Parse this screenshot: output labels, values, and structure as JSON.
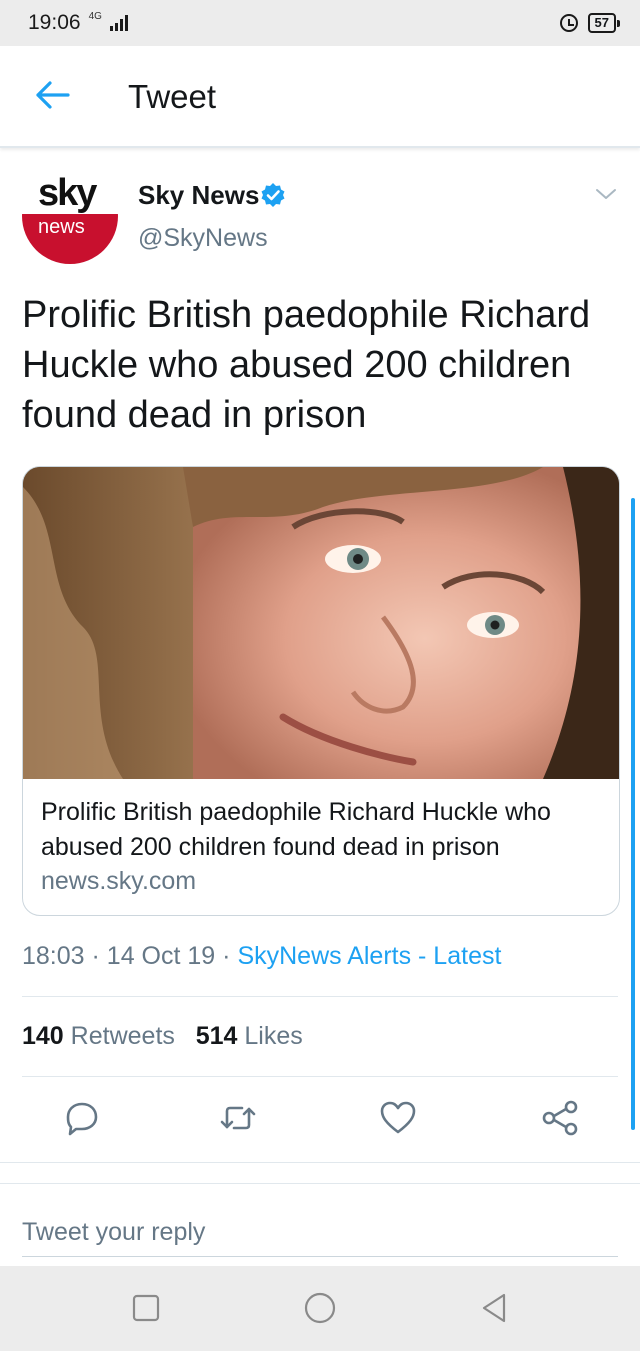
{
  "status_bar": {
    "time": "19:06",
    "network": "4G",
    "battery": "57"
  },
  "header": {
    "title": "Tweet"
  },
  "tweet": {
    "author": {
      "avatar_top_text": "sky",
      "avatar_bottom_text": "news",
      "name": "Sky News",
      "handle": "@SkyNews",
      "verified": true
    },
    "text": "Prolific British paedophile Richard Huckle who abused 200 children found dead in prison",
    "card": {
      "title": "Prolific British paedophile Richard Huckle who abused 200 children found dead in prison",
      "domain": "news.sky.com"
    },
    "meta": {
      "time": "18:03",
      "date": "14 Oct 19",
      "separator": "·",
      "source": "SkyNews Alerts - Latest"
    },
    "stats": {
      "retweets_count": "140",
      "retweets_label": "Retweets",
      "likes_count": "514",
      "likes_label": "Likes"
    },
    "actions": [
      "reply-icon",
      "retweet-icon",
      "like-icon",
      "share-icon"
    ]
  },
  "reply": {
    "placeholder": "Tweet your reply"
  },
  "colors": {
    "accent": "#1da1f2",
    "text": "#14171a",
    "secondary": "#657786",
    "sky_red": "#c8102e"
  }
}
